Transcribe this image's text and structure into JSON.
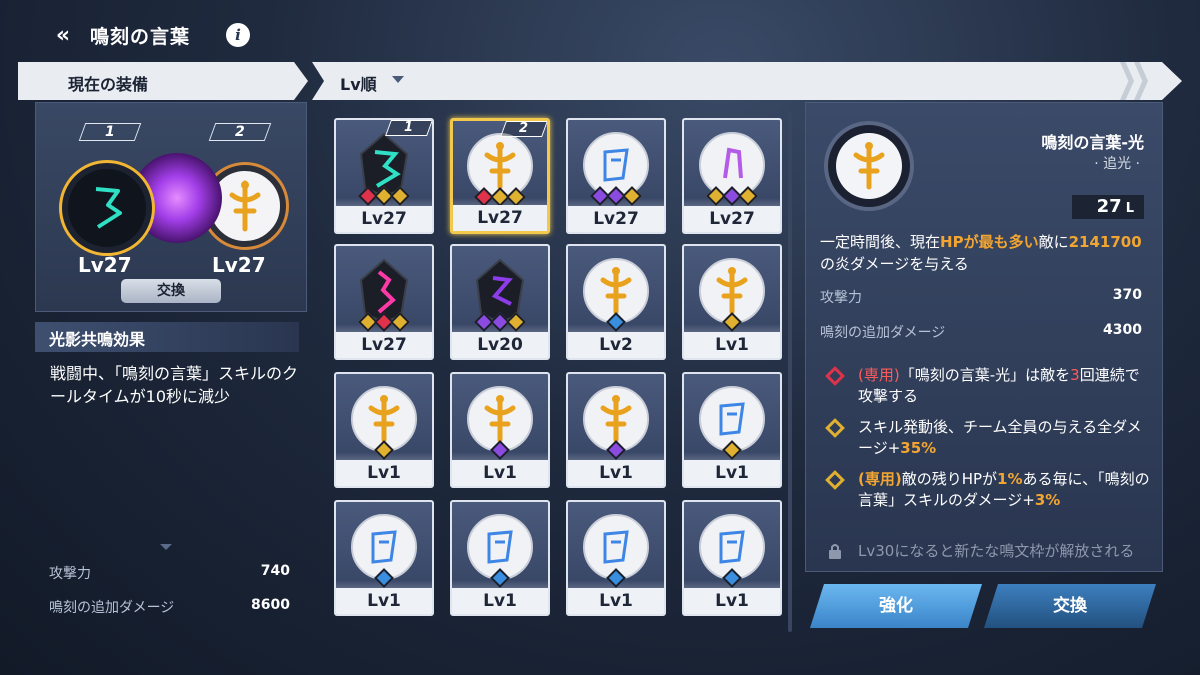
{
  "header": {
    "title": "鳴刻の言葉",
    "info": "i"
  },
  "left_tab": {
    "label": "現在の装備"
  },
  "sort": {
    "label": "Lv順"
  },
  "equipped": {
    "slot1": {
      "num": "1",
      "level": "Lv27"
    },
    "slot2": {
      "num": "2",
      "level": "Lv27"
    },
    "swap_label": "交換"
  },
  "resonance": {
    "title": "光影共鳴効果",
    "text": "戦闘中、「鳴刻の言葉」スキルのクールタイムが10秒に減少",
    "stats": [
      {
        "key": "攻撃力",
        "value": "740"
      },
      {
        "key": "鳴刻の追加ダメージ",
        "value": "8600"
      }
    ]
  },
  "cards": [
    {
      "level": "Lv27",
      "num": "1",
      "type": "dark-cyan",
      "gems": [
        "#e0324a",
        "#e0b030",
        "#e0b030"
      ]
    },
    {
      "level": "Lv27",
      "num": "2",
      "type": "gold",
      "gems": [
        "#e0324a",
        "#e0b030",
        "#e0b030"
      ],
      "selected": true
    },
    {
      "level": "Lv27",
      "type": "blue",
      "gems": [
        "#8c4be0",
        "#8c4be0",
        "#e0b030"
      ]
    },
    {
      "level": "Lv27",
      "type": "purple",
      "gems": [
        "#e0b030",
        "#8c4be0",
        "#e0b030"
      ]
    },
    {
      "level": "Lv27",
      "type": "dark-pink",
      "gems": [
        "#e0b030",
        "#e0324a",
        "#e0b030"
      ]
    },
    {
      "level": "Lv20",
      "type": "dark-purple",
      "gems": [
        "#8c4be0",
        "#8c4be0",
        "#e0b030"
      ]
    },
    {
      "level": "Lv2",
      "type": "gold",
      "gems": [
        "#3a8ee0"
      ]
    },
    {
      "level": "Lv1",
      "type": "gold",
      "gems": [
        "#e0b030"
      ]
    },
    {
      "level": "Lv1",
      "type": "gold",
      "gems": [
        "#e0b030"
      ]
    },
    {
      "level": "Lv1",
      "type": "gold",
      "gems": [
        "#8c4be0"
      ]
    },
    {
      "level": "Lv1",
      "type": "gold",
      "gems": [
        "#8c4be0"
      ]
    },
    {
      "level": "Lv1",
      "type": "blue",
      "gems": [
        "#e0b030"
      ]
    },
    {
      "level": "Lv1",
      "type": "blue",
      "gems": [
        "#3a8ee0"
      ]
    },
    {
      "level": "Lv1",
      "type": "blue",
      "gems": [
        "#3a8ee0"
      ]
    },
    {
      "level": "Lv1",
      "type": "blue",
      "gems": [
        "#3a8ee0"
      ]
    },
    {
      "level": "Lv1",
      "type": "blue",
      "gems": [
        "#3a8ee0"
      ]
    }
  ],
  "detail": {
    "name": "鳴刻の言葉-光",
    "tag": "追光",
    "level": "27",
    "level_suffix": "L",
    "desc_pre": "一定時間後、現在",
    "desc_hl1": "HPが最も多い",
    "desc_mid": "敵に",
    "desc_hl2": "2141700",
    "desc_post": "の炎ダメージを与える",
    "stats": [
      {
        "key": "攻撃力",
        "value": "370"
      },
      {
        "key": "鳴刻の追加ダメージ",
        "value": "4300"
      }
    ],
    "effects": [
      {
        "prefix": "(専用)",
        "text_a": "「鳴刻の言葉-光」は敵を",
        "num": "3",
        "text_b": "回連続で攻撃する",
        "gem": "#e0324a"
      },
      {
        "prefix": "",
        "text_a": "スキル発動後、チーム全員の与える全ダメージ+",
        "num": "35%",
        "text_b": "",
        "gem": "#e0b030"
      },
      {
        "prefix": "(専用)",
        "text_a": "敵の残りHPが",
        "num": "1%",
        "text_b": "ある毎に、「鳴刻の言葉」スキルのダメージ+",
        "num2": "3%",
        "gem": "#e0b030"
      }
    ],
    "locked": "Lv30になると新たな鳴文枠が解放される"
  },
  "buttons": {
    "upgrade": "強化",
    "swap": "交換"
  }
}
